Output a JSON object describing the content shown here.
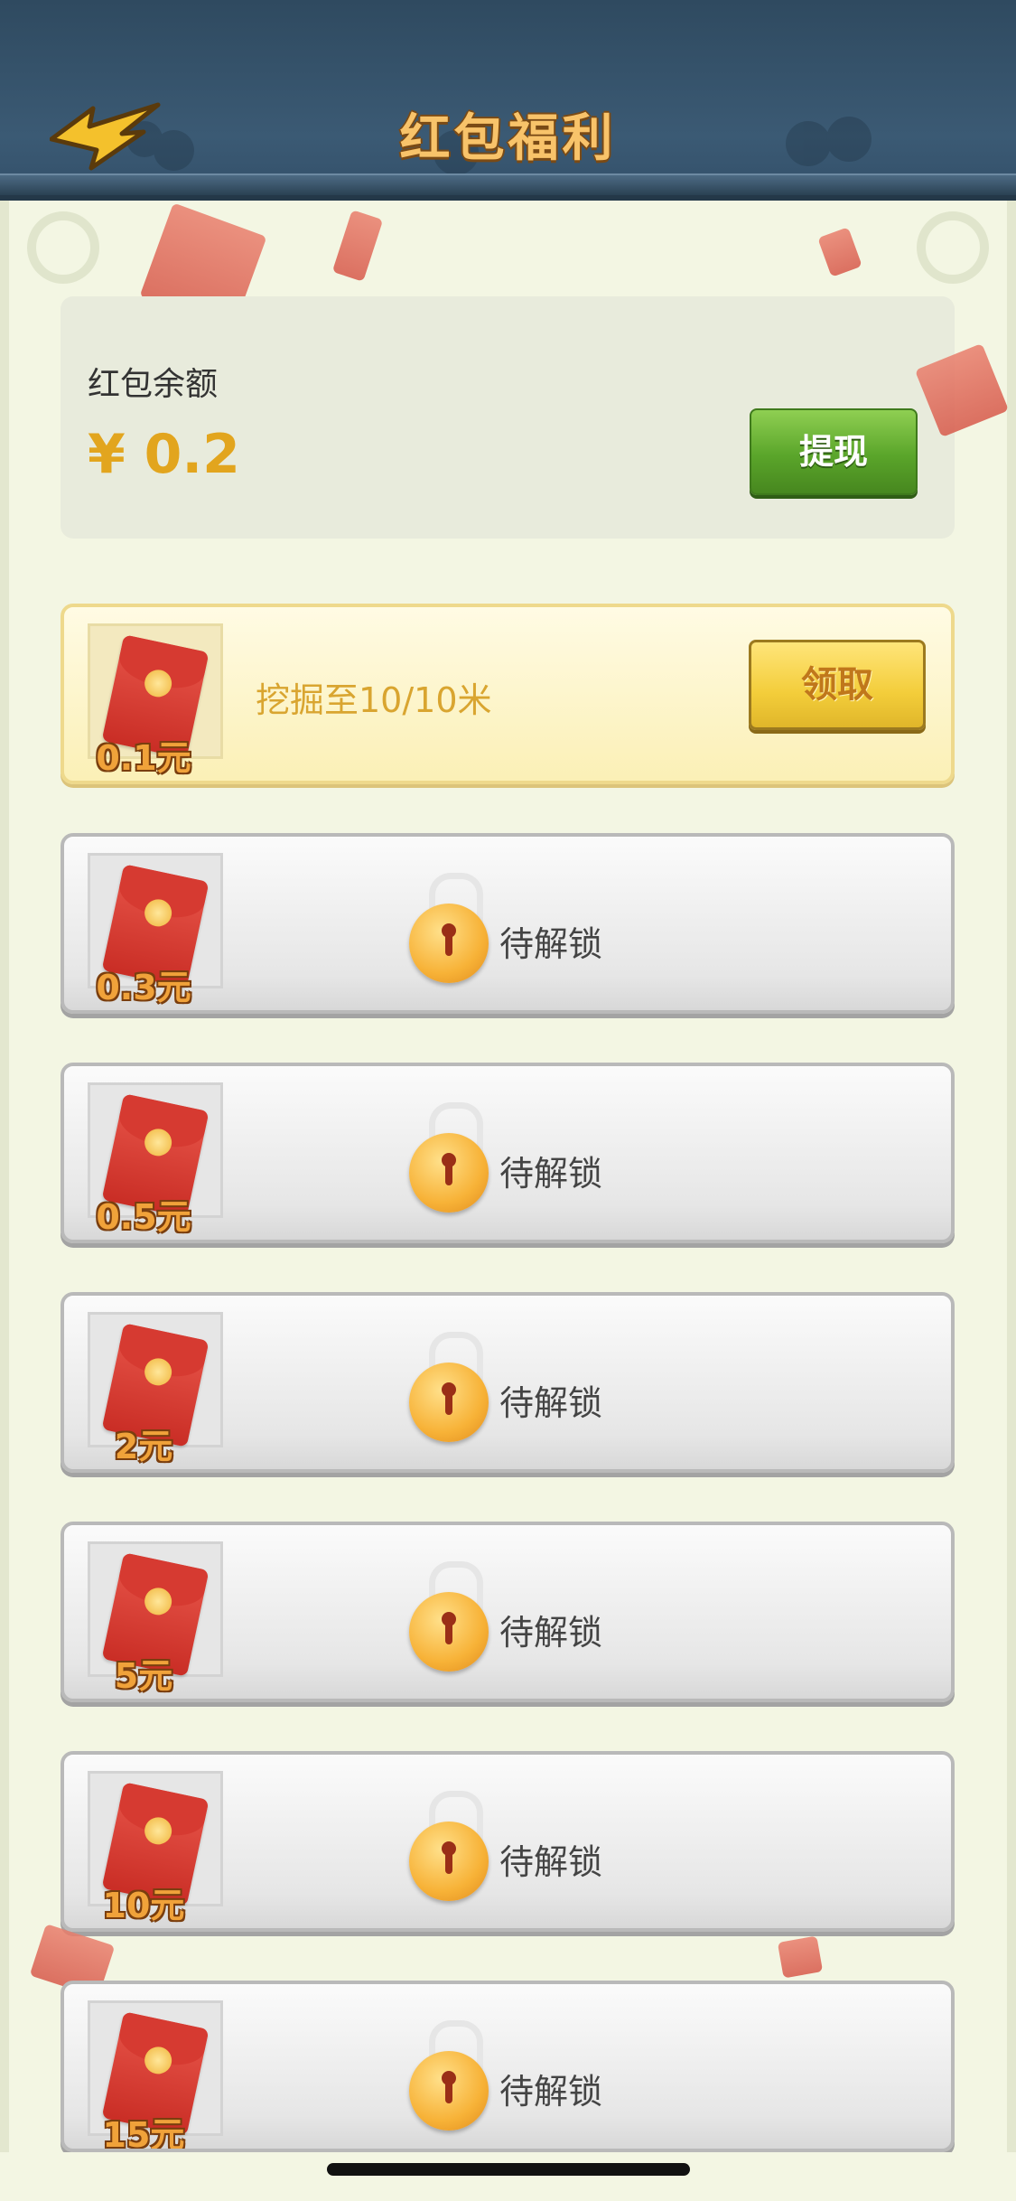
{
  "header": {
    "title": "红包福利",
    "back_icon": "lightning-arrow-back-icon"
  },
  "balance": {
    "label": "红包余额",
    "amount": "¥ 0.2",
    "withdraw_label": "提现"
  },
  "colors": {
    "header_bg": "#3b5a74",
    "title_color": "#f8c36a",
    "amount_color": "#e2a51e",
    "withdraw_green": "#5aa52a",
    "claim_yellow": "#f3cd3a",
    "envelope_red": "#c92d25"
  },
  "rewards": [
    {
      "amount": "0.1元",
      "state": "claimable",
      "task": "挖掘至10/10米",
      "action_label": "领取"
    },
    {
      "amount": "0.3元",
      "state": "locked",
      "status": "待解锁"
    },
    {
      "amount": "0.5元",
      "state": "locked",
      "status": "待解锁"
    },
    {
      "amount": "2元",
      "state": "locked",
      "status": "待解锁"
    },
    {
      "amount": "5元",
      "state": "locked",
      "status": "待解锁"
    },
    {
      "amount": "10元",
      "state": "locked",
      "status": "待解锁"
    },
    {
      "amount": "15元",
      "state": "locked",
      "status": "待解锁"
    }
  ]
}
